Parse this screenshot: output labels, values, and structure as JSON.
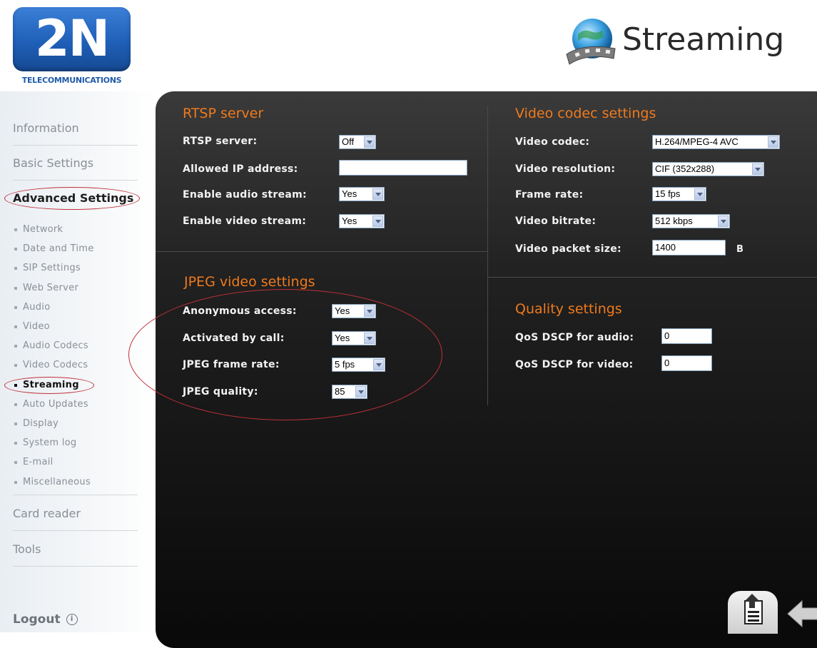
{
  "brand": {
    "logo_text": "2N",
    "logo_subtitle": "TELECOMMUNICATIONS"
  },
  "header": {
    "title": "Streaming",
    "icon": "film-globe-icon"
  },
  "sidebar": {
    "main": [
      {
        "label": "Information"
      },
      {
        "label": "Basic Settings"
      },
      {
        "label": "Advanced Settings",
        "active": true
      },
      {
        "label": "Card reader"
      },
      {
        "label": "Tools"
      }
    ],
    "sub": [
      {
        "label": "Network"
      },
      {
        "label": "Date and Time"
      },
      {
        "label": "SIP Settings"
      },
      {
        "label": "Web Server"
      },
      {
        "label": "Audio"
      },
      {
        "label": "Video"
      },
      {
        "label": "Audio Codecs"
      },
      {
        "label": "Video Codecs"
      },
      {
        "label": "Streaming",
        "active": true
      },
      {
        "label": "Auto Updates"
      },
      {
        "label": "Display"
      },
      {
        "label": "System log"
      },
      {
        "label": "E-mail"
      },
      {
        "label": "Miscellaneous"
      }
    ],
    "logout": "Logout"
  },
  "rtsp": {
    "title": "RTSP server",
    "server_label": "RTSP server:",
    "server_value": "Off",
    "ip_label": "Allowed IP address:",
    "ip_value": "",
    "audio_label": "Enable audio stream:",
    "audio_value": "Yes",
    "video_label": "Enable video stream:",
    "video_value": "Yes"
  },
  "jpeg": {
    "title": "JPEG video settings",
    "anon_label": "Anonymous access:",
    "anon_value": "Yes",
    "call_label": "Activated by call:",
    "call_value": "Yes",
    "rate_label": "JPEG frame rate:",
    "rate_value": "5 fps",
    "quality_label": "JPEG quality:",
    "quality_value": "85"
  },
  "video": {
    "title": "Video codec settings",
    "codec_label": "Video codec:",
    "codec_value": "H.264/MPEG-4 AVC",
    "res_label": "Video resolution:",
    "res_value": "CIF (352x288)",
    "rate_label": "Frame rate:",
    "rate_value": "15 fps",
    "bitrate_label": "Video bitrate:",
    "bitrate_value": "512 kbps",
    "packet_label": "Video packet size:",
    "packet_value": "1400",
    "packet_unit": "B"
  },
  "quality": {
    "title": "Quality settings",
    "audio_label": "QoS DSCP for audio:",
    "audio_value": "0",
    "video_label": "QoS DSCP for video:",
    "video_value": "0"
  },
  "colors": {
    "accent": "#f07a1c",
    "highlight_ring": "#c0303a",
    "brand_blue": "#1f5fb8"
  }
}
